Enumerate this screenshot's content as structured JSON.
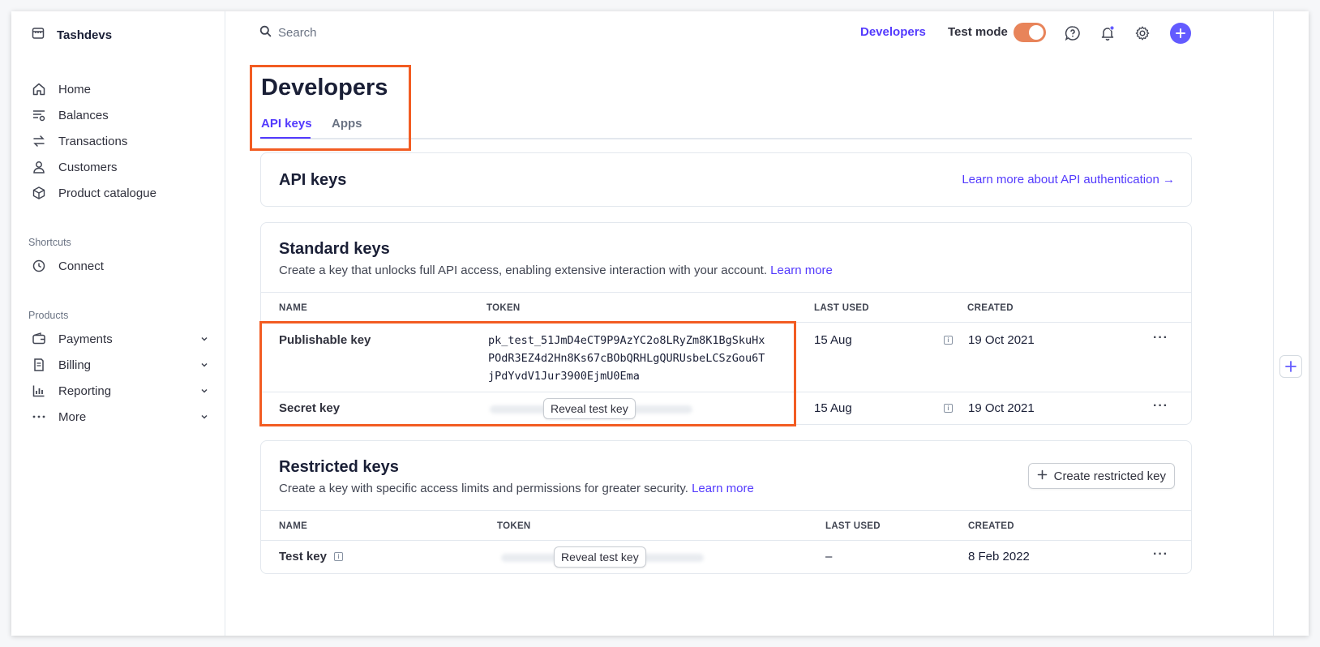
{
  "app": {
    "name": "Tashdevs"
  },
  "sidebar": {
    "items": [
      {
        "label": "Home",
        "icon": "home-icon"
      },
      {
        "label": "Balances",
        "icon": "balances-icon"
      },
      {
        "label": "Transactions",
        "icon": "transactions-icon"
      },
      {
        "label": "Customers",
        "icon": "customers-icon"
      },
      {
        "label": "Product catalogue",
        "icon": "box-icon"
      }
    ],
    "shortcuts_label": "Shortcuts",
    "shortcuts": [
      {
        "label": "Connect",
        "icon": "clock-icon"
      }
    ],
    "products_label": "Products",
    "products": [
      {
        "label": "Payments",
        "icon": "wallet-icon"
      },
      {
        "label": "Billing",
        "icon": "billing-icon"
      },
      {
        "label": "Reporting",
        "icon": "chart-icon"
      },
      {
        "label": "More",
        "icon": "more-icon"
      }
    ]
  },
  "topbar": {
    "search_placeholder": "Search",
    "developers_link": "Developers",
    "test_mode_label": "Test mode",
    "test_mode_on": true
  },
  "page": {
    "title": "Developers",
    "tabs": [
      {
        "label": "API keys",
        "active": true
      },
      {
        "label": "Apps",
        "active": false
      }
    ]
  },
  "api_keys_card": {
    "title": "API keys",
    "learn_more": "Learn more about API authentication →"
  },
  "standard_keys": {
    "title": "Standard keys",
    "description": "Create a key that unlocks full API access, enabling extensive interaction with your account.",
    "learn_more": "Learn more",
    "columns": [
      "NAME",
      "TOKEN",
      "LAST USED",
      "CREATED"
    ],
    "rows": [
      {
        "name": "Publishable key",
        "token": "pk_test_51JmD4eCT9P9AzYC2o8LRyZm8K1BgSkuHx\nPOdR3EZ4d2Hn8Ks67cBObQRHLgQURUsbeLCSzGou6T\njPdYvdV1Jur3900EjmU0Ema",
        "last_used": "15 Aug",
        "created": "19 Oct 2021",
        "actions": "···"
      },
      {
        "name": "Secret key",
        "reveal_label": "Reveal test key",
        "last_used": "15 Aug",
        "created": "19 Oct 2021",
        "actions": "···"
      }
    ]
  },
  "restricted_keys": {
    "title": "Restricted keys",
    "description": "Create a key with specific access limits and permissions for greater security.",
    "learn_more": "Learn more",
    "create_button": "Create restricted key",
    "columns": [
      "NAME",
      "TOKEN",
      "LAST USED",
      "CREATED"
    ],
    "rows": [
      {
        "name": "Test key",
        "reveal_label": "Reveal test key",
        "last_used": "–",
        "created": "8 Feb 2022",
        "actions": "···"
      }
    ]
  },
  "colors": {
    "accent": "#533afd",
    "highlight": "#f25c22",
    "toggle": "#e8845a"
  }
}
